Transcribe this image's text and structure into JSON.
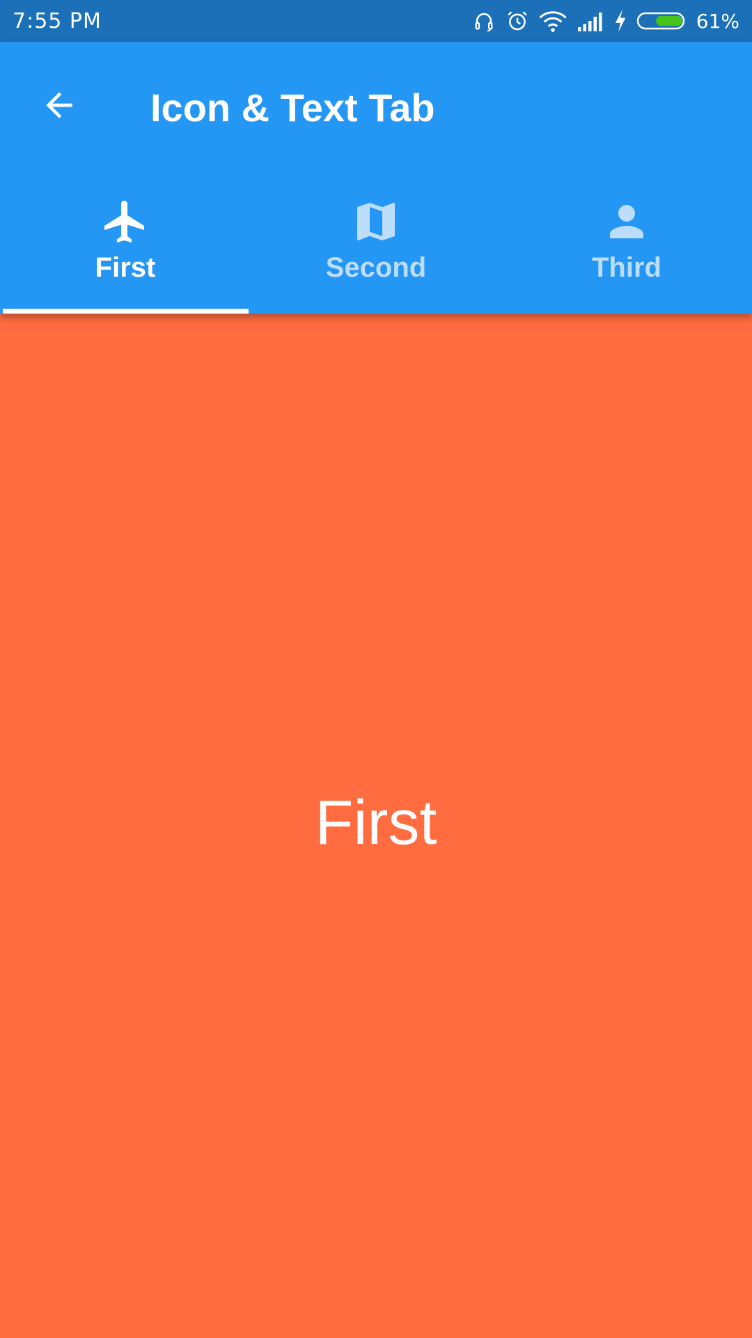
{
  "status_bar": {
    "time": "7:55 PM",
    "battery": "61%",
    "icons": [
      "headset-icon",
      "alarm-icon",
      "wifi-icon",
      "signal-icon",
      "charging-icon",
      "battery-icon"
    ],
    "battery_level": 0.61
  },
  "app_bar": {
    "title": "Icon & Text Tab",
    "back_icon": "arrow-back-icon"
  },
  "tabs": [
    {
      "label": "First",
      "icon": "airplane-icon",
      "selected": true
    },
    {
      "label": "Second",
      "icon": "map-icon",
      "selected": false
    },
    {
      "label": "Third",
      "icon": "person-icon",
      "selected": false
    }
  ],
  "content": {
    "text": "First"
  },
  "colors": {
    "status_bar": "#1C70B8",
    "app_bar": "#2496F3",
    "content_background": "#FF6C40",
    "inactive_tab": "#BCDDFB"
  }
}
